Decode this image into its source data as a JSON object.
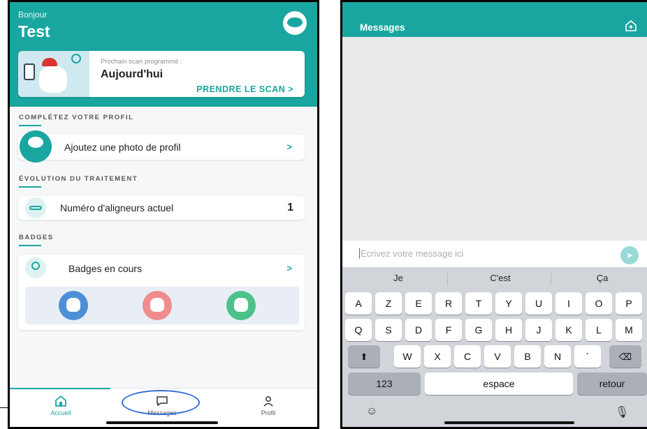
{
  "left": {
    "greeting": "Bonjour",
    "user_name": "Test",
    "scan_card": {
      "subtitle": "Prochain scan programmé :",
      "title": "Aujourd'hui",
      "action": "PRENDRE LE SCAN  >"
    },
    "profile_section": {
      "heading": "COMPLÉTEZ VOTRE PROFIL",
      "add_photo": "Ajoutez une photo de profil",
      "chevron": ">"
    },
    "treatment_section": {
      "heading": "ÉVOLUTION DU TRAITEMENT",
      "aligner_label": "Numéro d'aligneurs actuel",
      "aligner_value": "1"
    },
    "badges_section": {
      "heading": "BADGES",
      "in_progress": "Badges en cours",
      "chevron": ">",
      "badge_colors": [
        "#4d8fd6",
        "#f08c8c",
        "#4cc28a"
      ]
    },
    "tabbar": {
      "home": "Accueil",
      "messages": "Messages",
      "profile": "Profil"
    }
  },
  "right": {
    "header_title": "Messages",
    "input_placeholder": "Ecrivez votre message ici",
    "suggestions": [
      "Je",
      "C'est",
      "Ça"
    ],
    "row1": [
      "A",
      "Z",
      "E",
      "R",
      "T",
      "Y",
      "U",
      "I",
      "O",
      "P"
    ],
    "row2": [
      "Q",
      "S",
      "D",
      "F",
      "G",
      "H",
      "J",
      "K",
      "L",
      "M"
    ],
    "row3": [
      "W",
      "X",
      "C",
      "V",
      "B",
      "N",
      "´"
    ],
    "key_123": "123",
    "key_space": "espace",
    "key_return": "retour"
  },
  "colors": {
    "accent": "#1aa6a0",
    "highlight": "#2f6fd8"
  }
}
